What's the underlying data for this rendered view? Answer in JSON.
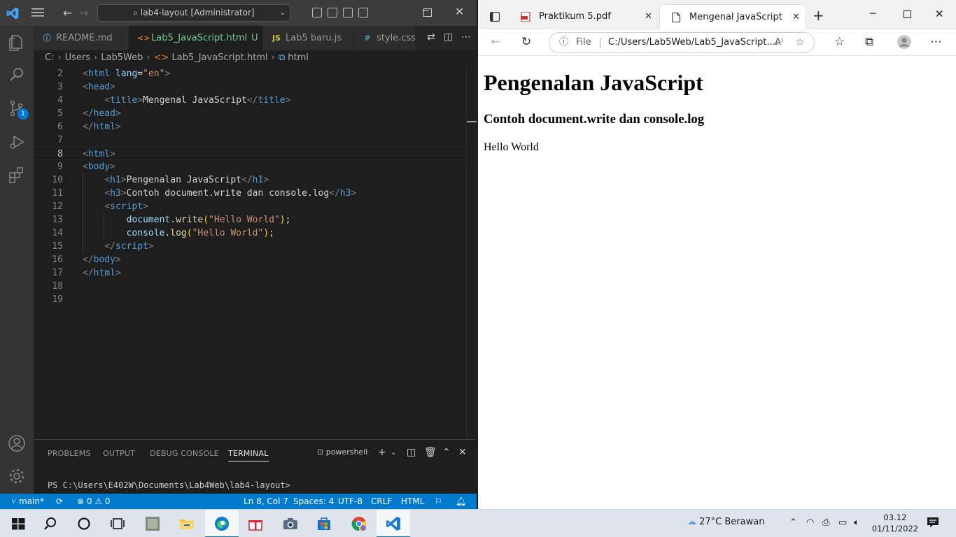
{
  "vscode": {
    "window_title": "lab4-layout [Administrator]",
    "tabs": [
      {
        "label": "README.md",
        "icon": "info-icon",
        "active": false
      },
      {
        "label": "Lab5_JavaScript.html",
        "modified": "U",
        "icon": "html-icon",
        "active": true
      },
      {
        "label": "Lab5 baru.js",
        "icon": "js-icon",
        "active": false
      },
      {
        "label": "style.css",
        "icon": "css-icon",
        "active": false
      }
    ],
    "breadcrumb": [
      "C:",
      "Users",
      "Lab5Web",
      "Lab5_JavaScript.html",
      "html"
    ],
    "activity_badge": "1",
    "code": {
      "lines": [
        {
          "n": "2"
        },
        {
          "n": "3"
        },
        {
          "n": "4"
        },
        {
          "n": "5"
        },
        {
          "n": "6"
        },
        {
          "n": "7"
        },
        {
          "n": "8"
        },
        {
          "n": "9"
        },
        {
          "n": "10"
        },
        {
          "n": "11"
        },
        {
          "n": "12"
        },
        {
          "n": "13"
        },
        {
          "n": "14"
        },
        {
          "n": "15"
        },
        {
          "n": "16"
        },
        {
          "n": "17"
        },
        {
          "n": "18"
        },
        {
          "n": "19"
        }
      ],
      "strings": {
        "html": "html",
        "head": "head",
        "title": "title",
        "body": "body",
        "h1": "h1",
        "h3": "h3",
        "script": "script",
        "lang_attr": "lang",
        "lang_val": "\"en\"",
        "title_text": "Mengenal JavaScript",
        "h1_text": "Pengenalan JavaScript",
        "h3_text": "Contoh document.write dan console.log",
        "document": "document",
        "write": "write",
        "console": "console",
        "log": "log",
        "hello": "\"Hello World\""
      }
    },
    "panel": {
      "tabs": [
        "PROBLEMS",
        "OUTPUT",
        "DEBUG CONSOLE",
        "TERMINAL"
      ],
      "active_tab": "TERMINAL",
      "shell": "powershell",
      "prompt": "PS C:\\Users\\E402W\\Documents\\Lab4Web\\lab4-layout>"
    },
    "status": {
      "branch": "main*",
      "errors": "0",
      "warnings": "0",
      "position": "Ln 8, Col 7",
      "spaces": "Spaces: 4",
      "encoding": "UTF-8",
      "eol": "CRLF",
      "language": "HTML"
    }
  },
  "edge": {
    "tabs": [
      {
        "label": "Praktikum 5.pdf",
        "icon": "pdf-icon",
        "active": false
      },
      {
        "label": "Mengenal JavaScript",
        "icon": "page-icon",
        "active": true
      }
    ],
    "address": {
      "scheme_label": "File",
      "url": "C:/Users/Lab5Web/Lab5_JavaScript...."
    },
    "page": {
      "h1": "Pengenalan JavaScript",
      "h3": "Contoh document.write dan console.log",
      "text": "Hello World"
    }
  },
  "taskbar": {
    "weather": "27°C  Berawan",
    "time": "03.12",
    "date": "01/11/2022"
  },
  "colors": {
    "vscode_status": "#007acc",
    "vscode_title": "#3c3c3c",
    "tag": "#569cd6",
    "string": "#ce9178",
    "function": "#dcdcaa",
    "variable": "#9cdcfe",
    "modified": "#73c991"
  }
}
